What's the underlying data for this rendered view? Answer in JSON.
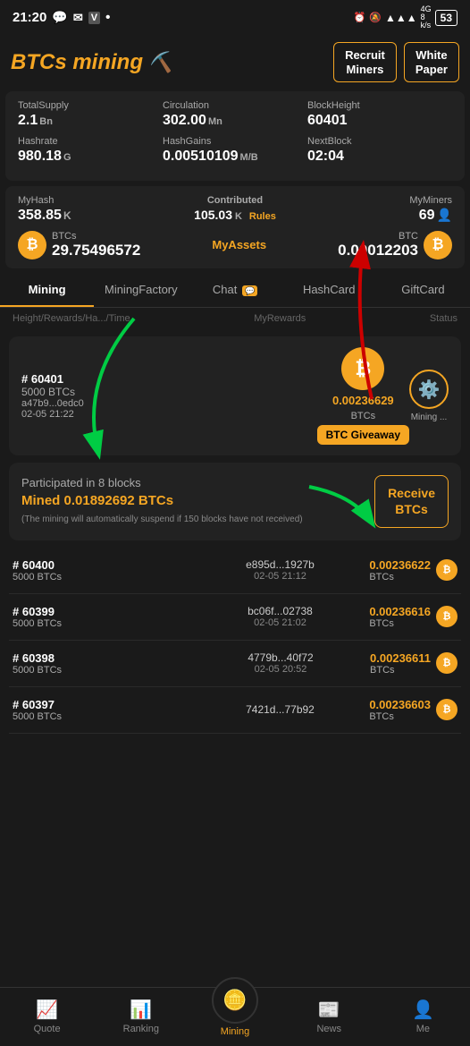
{
  "statusBar": {
    "time": "21:20",
    "icons": [
      "whatsapp",
      "message",
      "vpn",
      "dot",
      "alarm",
      "mute",
      "signal",
      "battery"
    ]
  },
  "header": {
    "logo": "BTCs mining",
    "logoEmoji": "⛏️",
    "recruitBtn": "Recruit\nMiners",
    "whitePaperBtn": "White\nPaper"
  },
  "stats": {
    "row1": [
      {
        "label": "TotalSupply",
        "value": "2.1",
        "unit": "Bn"
      },
      {
        "label": "Circulation",
        "value": "302.00",
        "unit": "Mn"
      },
      {
        "label": "BlockHeight",
        "value": "60401",
        "unit": ""
      }
    ],
    "row2": [
      {
        "label": "Hashrate",
        "value": "980.18",
        "unit": "G"
      },
      {
        "label": "HashGains",
        "value": "0.00510109",
        "unit": "M/B"
      },
      {
        "label": "NextBlock",
        "value": "02:04",
        "unit": ""
      }
    ]
  },
  "myAssets": {
    "myHash": {
      "label": "MyHash",
      "value": "358.85",
      "unit": "K"
    },
    "contributed": {
      "label": "Contributed",
      "value": "105.03",
      "unit": "K",
      "sub": "Rules"
    },
    "myMiners": {
      "label": "MyMiners",
      "value": "69",
      "icon": "👤"
    },
    "centerLabel": "MyAssets",
    "btcs": {
      "label": "BTCs",
      "value": "29.75496572"
    },
    "btc": {
      "label": "BTC",
      "value": "0.00012203"
    }
  },
  "tabs": [
    {
      "id": "mining",
      "label": "Mining",
      "active": true
    },
    {
      "id": "miningfactory",
      "label": "MiningFactory",
      "active": false
    },
    {
      "id": "chat",
      "label": "Chat",
      "active": false,
      "badge": "💬"
    },
    {
      "id": "hashcard",
      "label": "HashCard",
      "active": false
    },
    {
      "id": "giftcard",
      "label": "GiftCard",
      "active": false
    }
  ],
  "tableHeader": {
    "col1": "Height/Rewards/Ha.../Time",
    "col2": "MyRewards",
    "col3": "Status"
  },
  "featuredBlock": {
    "num": "# 60401",
    "btcs": "5000 BTCs",
    "hash": "a47b9...0edc0",
    "time": "02-05 21:22",
    "giveawayAmount": "0.00236629",
    "giveawayUnit": "BTCs",
    "giveawayBtn": "BTC Giveaway",
    "statusLabel": "Mining ..."
  },
  "participatedBlock": {
    "title": "Participated in 8 blocks",
    "mined": "Mined 0.01892692 BTCs",
    "note": "(The mining will automatically suspend\nif 150 blocks have not received)",
    "receiveBtn": "Receive\nBTCs"
  },
  "miningRows": [
    {
      "num": "# 60400",
      "btcs": "5000 BTCs",
      "hash": "e895d...1927b",
      "time": "02-05 21:12",
      "amount": "0.00236622",
      "unit": "BTCs"
    },
    {
      "num": "# 60399",
      "btcs": "5000 BTCs",
      "hash": "bc06f...02738",
      "time": "02-05 21:02",
      "amount": "0.00236616",
      "unit": "BTCs"
    },
    {
      "num": "# 60398",
      "btcs": "5000 BTCs",
      "hash": "4779b...40f72",
      "time": "02-05 20:52",
      "amount": "0.00236611",
      "unit": "BTCs"
    },
    {
      "num": "# 60397",
      "btcs": "5000 BTCs",
      "hash": "7421d...77b92",
      "time": "",
      "amount": "0.00236603",
      "unit": "BTCs"
    }
  ],
  "bottomNav": [
    {
      "id": "quote",
      "label": "Quote",
      "icon": "📈",
      "active": false
    },
    {
      "id": "ranking",
      "label": "Ranking",
      "icon": "📊",
      "active": false
    },
    {
      "id": "mining",
      "label": "Mining",
      "icon": "🪙",
      "active": true
    },
    {
      "id": "news",
      "label": "News",
      "icon": "📰",
      "active": false
    },
    {
      "id": "me",
      "label": "Me",
      "icon": "👤",
      "active": false
    }
  ]
}
